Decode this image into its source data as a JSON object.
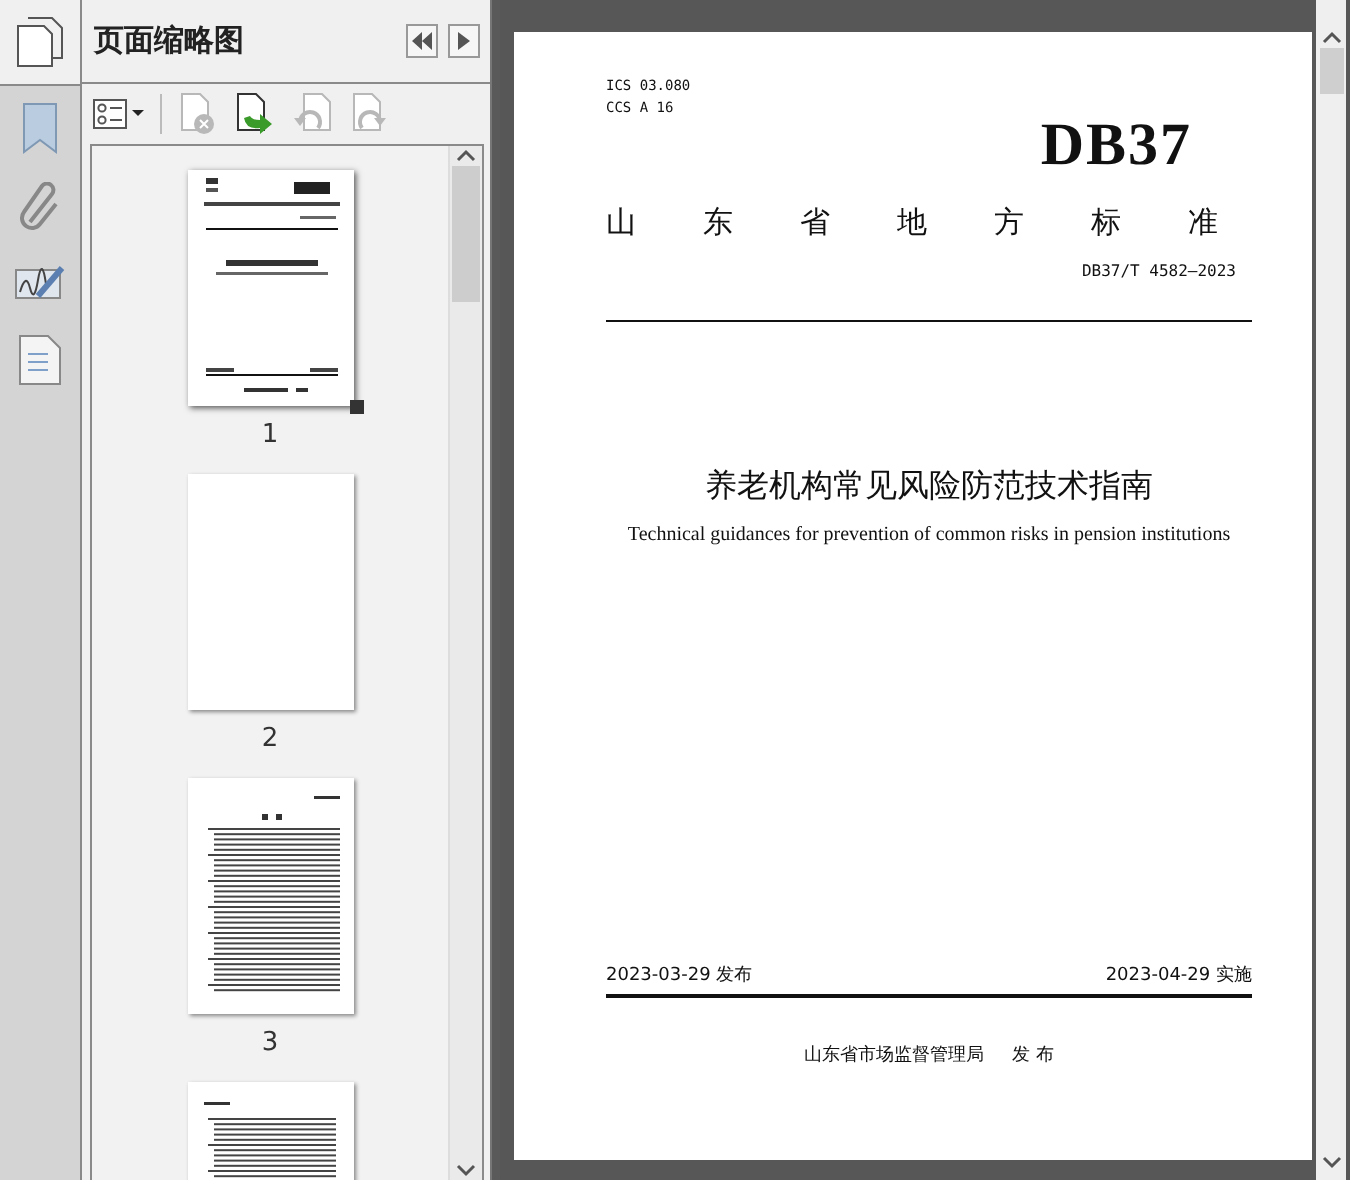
{
  "panel": {
    "title": "页面缩略图"
  },
  "toolbar": [
    {
      "kind": "options",
      "disabled": false
    },
    {
      "kind": "delete",
      "disabled": true
    },
    {
      "kind": "insert",
      "disabled": false
    },
    {
      "kind": "rotate-left",
      "disabled": true
    },
    {
      "kind": "rotate-right",
      "disabled": true
    }
  ],
  "thumbnails": [
    {
      "kind": "cover",
      "label": "1",
      "selected": true
    },
    {
      "kind": "blank",
      "label": "2",
      "selected": false
    },
    {
      "kind": "contents",
      "label": "3",
      "selected": false
    },
    {
      "kind": "list",
      "selected": false
    }
  ],
  "document": {
    "ics": "ICS  03.080",
    "ccs": "CCS  A 16",
    "logo": "DB37",
    "heading": "山东省地方标准",
    "code": "DB37/T 4582—2023",
    "title": "养老机构常见风险防范技术指南",
    "subtitle": "Technical guidances for prevention of common risks in pension institutions",
    "release_date": "2023-03-29 发布",
    "effective_date": "2023-04-29 实施",
    "issuer": "山东省市场监督管理局",
    "issued": "发 布"
  }
}
